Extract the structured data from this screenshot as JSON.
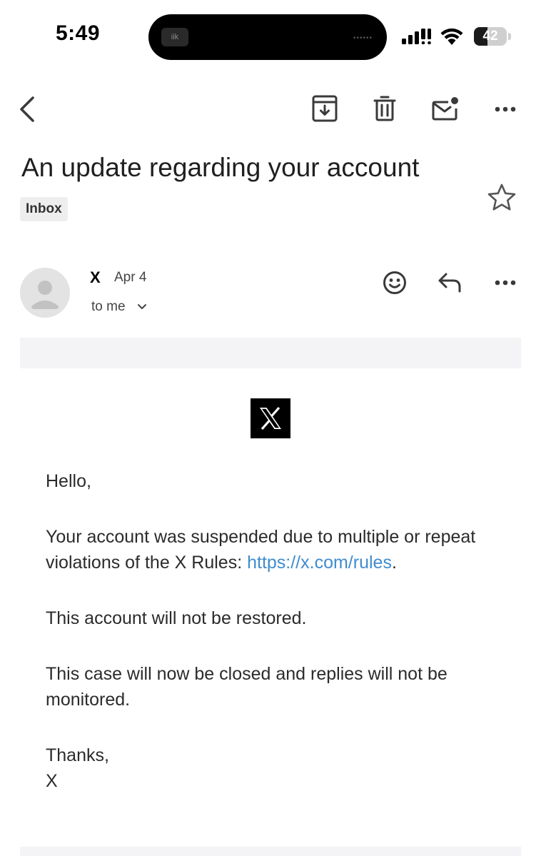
{
  "status_bar": {
    "time": "5:49",
    "island_app": "iik",
    "battery_level": "42",
    "battery_fraction": 0.42,
    "icons": [
      "signal-icon",
      "wifi-icon",
      "battery-icon"
    ]
  },
  "toolbar": {
    "icons": [
      "back-icon",
      "archive-icon",
      "delete-icon",
      "mark-unread-icon",
      "more-options-icon"
    ]
  },
  "email": {
    "subject": "An update regarding your account",
    "label": "Inbox",
    "sender": "X",
    "date": "Apr 4",
    "recipient": "to me",
    "starred": false
  },
  "body": {
    "greeting": "Hello,",
    "para1_text": "Your account was suspended due to multiple or repeat violations of the X Rules: ",
    "para1_link": "https://x.com/rules",
    "para1_end": ".",
    "para2": "This account will not be restored.",
    "para3": "This case will now be closed and replies will not be monitored.",
    "signoff": "Thanks,",
    "signature": "X"
  },
  "colors": {
    "link": "#3f8ccf",
    "band": "#f4f4f6",
    "chip": "#eeeeee"
  }
}
